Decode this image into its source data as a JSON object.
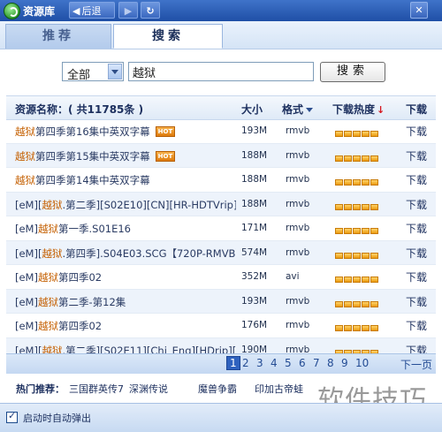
{
  "window": {
    "title": "资源库",
    "back_label": "后退",
    "back_arrow": "◀",
    "forward_arrow": "▶",
    "refresh_glyph": "↻",
    "close_glyph": "✕",
    "min_glyph": "–"
  },
  "tabs": [
    {
      "label": "推荐",
      "active": false
    },
    {
      "label": "搜索",
      "active": true
    }
  ],
  "search": {
    "category_selected": "全部",
    "query": "越狱",
    "button_label": "搜索"
  },
  "table": {
    "header": {
      "name_label": "资源名称：( 共11785条 )",
      "size_label": "大小",
      "format_label": "格式",
      "heat_label": "下载热度",
      "heat_sort_glyph": "↓",
      "download_label": "下载"
    },
    "rows": [
      {
        "kw": "越狱",
        "rest": "第四季第16集中英双字幕",
        "hot": true,
        "prefix": "",
        "size": "193M",
        "format": "rmvb",
        "heat": 5,
        "download": "下载"
      },
      {
        "kw": "越狱",
        "rest": "第四季第15集中英双字幕",
        "hot": true,
        "prefix": "",
        "size": "188M",
        "format": "rmvb",
        "heat": 5,
        "download": "下载"
      },
      {
        "kw": "越狱",
        "rest": "第四季第14集中英双字幕",
        "hot": false,
        "prefix": "",
        "size": "188M",
        "format": "rmvb",
        "heat": 5,
        "download": "下载"
      },
      {
        "kw": "越狱",
        "rest": ".第二季][S02E10][CN][HR-HDTVrip]",
        "hot": false,
        "prefix": "[eM][",
        "size": "188M",
        "format": "rmvb",
        "heat": 5,
        "download": "下载"
      },
      {
        "kw": "越狱",
        "rest": "第一季.S01E16",
        "hot": false,
        "prefix": "[eM]",
        "size": "171M",
        "format": "rmvb",
        "heat": 5,
        "download": "下载"
      },
      {
        "kw": "越狱",
        "rest": ".第四季].S04E03.SCG【720P-RMVB】",
        "hot": false,
        "prefix": "[eM][",
        "size": "574M",
        "format": "rmvb",
        "heat": 5,
        "download": "下载"
      },
      {
        "kw": "越狱",
        "rest": "第四季02",
        "hot": false,
        "prefix": "[eM]",
        "size": "352M",
        "format": "avi",
        "heat": 5,
        "download": "下载"
      },
      {
        "kw": "越狱",
        "rest": "第二季-第12集",
        "hot": false,
        "prefix": "[eM]",
        "size": "193M",
        "format": "rmvb",
        "heat": 5,
        "download": "下载"
      },
      {
        "kw": "越狱",
        "rest": "第四季02",
        "hot": false,
        "prefix": "[eM]",
        "size": "176M",
        "format": "rmvb",
        "heat": 5,
        "download": "下载"
      },
      {
        "kw": "越狱",
        "rest": ".第二季][S02E11][Chi_Eng][HDrip][",
        "hot": false,
        "prefix": "[eM][",
        "size": "190M",
        "format": "rmvb",
        "heat": 5,
        "download": "下载"
      }
    ]
  },
  "pager": {
    "pages": [
      "1",
      "2",
      "3",
      "4",
      "5",
      "6",
      "7",
      "8",
      "9",
      "10"
    ],
    "current": "1",
    "next_label": "下一页"
  },
  "hot_searches": {
    "label": "热门推荐：",
    "items": [
      "三国群英传7",
      "深渊传说",
      "魔兽争霸",
      "印加古帝蛙"
    ]
  },
  "footer": {
    "autostart_label": "启动时自动弹出",
    "autostart_checked": true
  },
  "watermark_text": "软件技巧",
  "colors": {
    "keyword": "#c45f00",
    "accent": "#2f62bf",
    "heat_bar": "#eb9a0e"
  }
}
